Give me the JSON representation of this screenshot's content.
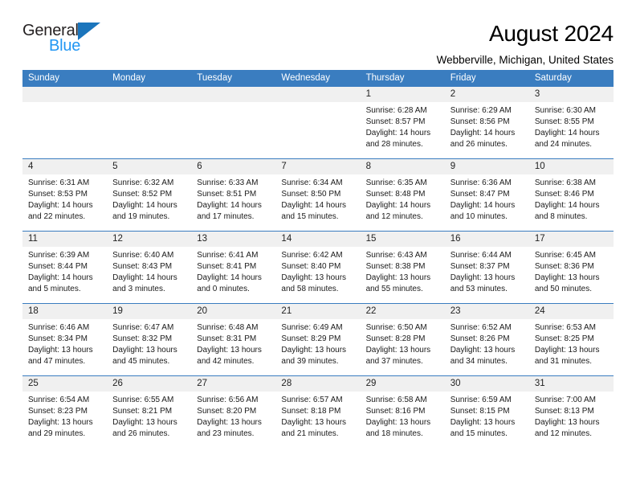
{
  "brand": {
    "line1": "General",
    "line2": "Blue",
    "triangle_icon": "triangle-icon",
    "accent_dark": "#231f20",
    "accent_blue": "#2196f3",
    "triangle_blue": "#1b75bc"
  },
  "header": {
    "title": "August 2024",
    "location": "Webberville, Michigan, United States"
  },
  "theme": {
    "header_bg": "#3a7dc0",
    "daynum_bg": "#f0f0f0",
    "row_border": "#3a7dc0"
  },
  "weekdays": [
    "Sunday",
    "Monday",
    "Tuesday",
    "Wednesday",
    "Thursday",
    "Friday",
    "Saturday"
  ],
  "weeks": [
    [
      {
        "day": "",
        "empty": true
      },
      {
        "day": "",
        "empty": true
      },
      {
        "day": "",
        "empty": true
      },
      {
        "day": "",
        "empty": true
      },
      {
        "day": "1",
        "sunrise": "Sunrise: 6:28 AM",
        "sunset": "Sunset: 8:57 PM",
        "daylight1": "Daylight: 14 hours",
        "daylight2": "and 28 minutes."
      },
      {
        "day": "2",
        "sunrise": "Sunrise: 6:29 AM",
        "sunset": "Sunset: 8:56 PM",
        "daylight1": "Daylight: 14 hours",
        "daylight2": "and 26 minutes."
      },
      {
        "day": "3",
        "sunrise": "Sunrise: 6:30 AM",
        "sunset": "Sunset: 8:55 PM",
        "daylight1": "Daylight: 14 hours",
        "daylight2": "and 24 minutes."
      }
    ],
    [
      {
        "day": "4",
        "sunrise": "Sunrise: 6:31 AM",
        "sunset": "Sunset: 8:53 PM",
        "daylight1": "Daylight: 14 hours",
        "daylight2": "and 22 minutes."
      },
      {
        "day": "5",
        "sunrise": "Sunrise: 6:32 AM",
        "sunset": "Sunset: 8:52 PM",
        "daylight1": "Daylight: 14 hours",
        "daylight2": "and 19 minutes."
      },
      {
        "day": "6",
        "sunrise": "Sunrise: 6:33 AM",
        "sunset": "Sunset: 8:51 PM",
        "daylight1": "Daylight: 14 hours",
        "daylight2": "and 17 minutes."
      },
      {
        "day": "7",
        "sunrise": "Sunrise: 6:34 AM",
        "sunset": "Sunset: 8:50 PM",
        "daylight1": "Daylight: 14 hours",
        "daylight2": "and 15 minutes."
      },
      {
        "day": "8",
        "sunrise": "Sunrise: 6:35 AM",
        "sunset": "Sunset: 8:48 PM",
        "daylight1": "Daylight: 14 hours",
        "daylight2": "and 12 minutes."
      },
      {
        "day": "9",
        "sunrise": "Sunrise: 6:36 AM",
        "sunset": "Sunset: 8:47 PM",
        "daylight1": "Daylight: 14 hours",
        "daylight2": "and 10 minutes."
      },
      {
        "day": "10",
        "sunrise": "Sunrise: 6:38 AM",
        "sunset": "Sunset: 8:46 PM",
        "daylight1": "Daylight: 14 hours",
        "daylight2": "and 8 minutes."
      }
    ],
    [
      {
        "day": "11",
        "sunrise": "Sunrise: 6:39 AM",
        "sunset": "Sunset: 8:44 PM",
        "daylight1": "Daylight: 14 hours",
        "daylight2": "and 5 minutes."
      },
      {
        "day": "12",
        "sunrise": "Sunrise: 6:40 AM",
        "sunset": "Sunset: 8:43 PM",
        "daylight1": "Daylight: 14 hours",
        "daylight2": "and 3 minutes."
      },
      {
        "day": "13",
        "sunrise": "Sunrise: 6:41 AM",
        "sunset": "Sunset: 8:41 PM",
        "daylight1": "Daylight: 14 hours",
        "daylight2": "and 0 minutes."
      },
      {
        "day": "14",
        "sunrise": "Sunrise: 6:42 AM",
        "sunset": "Sunset: 8:40 PM",
        "daylight1": "Daylight: 13 hours",
        "daylight2": "and 58 minutes."
      },
      {
        "day": "15",
        "sunrise": "Sunrise: 6:43 AM",
        "sunset": "Sunset: 8:38 PM",
        "daylight1": "Daylight: 13 hours",
        "daylight2": "and 55 minutes."
      },
      {
        "day": "16",
        "sunrise": "Sunrise: 6:44 AM",
        "sunset": "Sunset: 8:37 PM",
        "daylight1": "Daylight: 13 hours",
        "daylight2": "and 53 minutes."
      },
      {
        "day": "17",
        "sunrise": "Sunrise: 6:45 AM",
        "sunset": "Sunset: 8:36 PM",
        "daylight1": "Daylight: 13 hours",
        "daylight2": "and 50 minutes."
      }
    ],
    [
      {
        "day": "18",
        "sunrise": "Sunrise: 6:46 AM",
        "sunset": "Sunset: 8:34 PM",
        "daylight1": "Daylight: 13 hours",
        "daylight2": "and 47 minutes."
      },
      {
        "day": "19",
        "sunrise": "Sunrise: 6:47 AM",
        "sunset": "Sunset: 8:32 PM",
        "daylight1": "Daylight: 13 hours",
        "daylight2": "and 45 minutes."
      },
      {
        "day": "20",
        "sunrise": "Sunrise: 6:48 AM",
        "sunset": "Sunset: 8:31 PM",
        "daylight1": "Daylight: 13 hours",
        "daylight2": "and 42 minutes."
      },
      {
        "day": "21",
        "sunrise": "Sunrise: 6:49 AM",
        "sunset": "Sunset: 8:29 PM",
        "daylight1": "Daylight: 13 hours",
        "daylight2": "and 39 minutes."
      },
      {
        "day": "22",
        "sunrise": "Sunrise: 6:50 AM",
        "sunset": "Sunset: 8:28 PM",
        "daylight1": "Daylight: 13 hours",
        "daylight2": "and 37 minutes."
      },
      {
        "day": "23",
        "sunrise": "Sunrise: 6:52 AM",
        "sunset": "Sunset: 8:26 PM",
        "daylight1": "Daylight: 13 hours",
        "daylight2": "and 34 minutes."
      },
      {
        "day": "24",
        "sunrise": "Sunrise: 6:53 AM",
        "sunset": "Sunset: 8:25 PM",
        "daylight1": "Daylight: 13 hours",
        "daylight2": "and 31 minutes."
      }
    ],
    [
      {
        "day": "25",
        "sunrise": "Sunrise: 6:54 AM",
        "sunset": "Sunset: 8:23 PM",
        "daylight1": "Daylight: 13 hours",
        "daylight2": "and 29 minutes."
      },
      {
        "day": "26",
        "sunrise": "Sunrise: 6:55 AM",
        "sunset": "Sunset: 8:21 PM",
        "daylight1": "Daylight: 13 hours",
        "daylight2": "and 26 minutes."
      },
      {
        "day": "27",
        "sunrise": "Sunrise: 6:56 AM",
        "sunset": "Sunset: 8:20 PM",
        "daylight1": "Daylight: 13 hours",
        "daylight2": "and 23 minutes."
      },
      {
        "day": "28",
        "sunrise": "Sunrise: 6:57 AM",
        "sunset": "Sunset: 8:18 PM",
        "daylight1": "Daylight: 13 hours",
        "daylight2": "and 21 minutes."
      },
      {
        "day": "29",
        "sunrise": "Sunrise: 6:58 AM",
        "sunset": "Sunset: 8:16 PM",
        "daylight1": "Daylight: 13 hours",
        "daylight2": "and 18 minutes."
      },
      {
        "day": "30",
        "sunrise": "Sunrise: 6:59 AM",
        "sunset": "Sunset: 8:15 PM",
        "daylight1": "Daylight: 13 hours",
        "daylight2": "and 15 minutes."
      },
      {
        "day": "31",
        "sunrise": "Sunrise: 7:00 AM",
        "sunset": "Sunset: 8:13 PM",
        "daylight1": "Daylight: 13 hours",
        "daylight2": "and 12 minutes."
      }
    ]
  ]
}
